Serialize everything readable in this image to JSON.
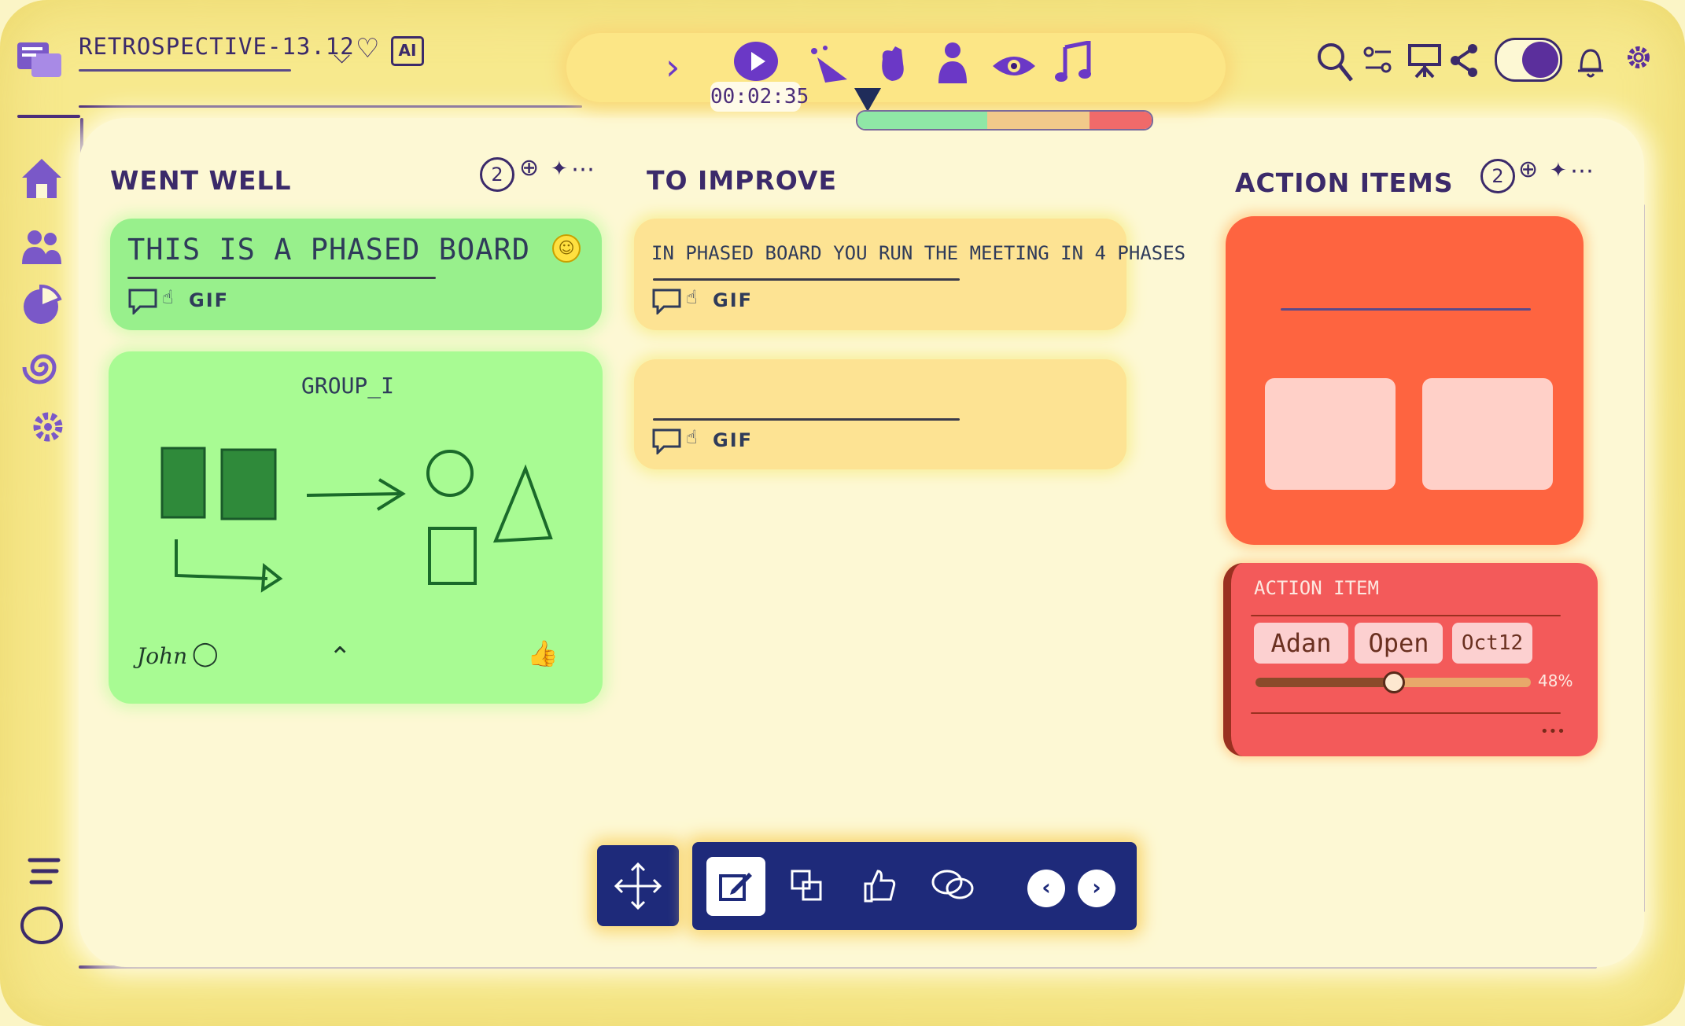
{
  "header": {
    "title": "RETROSPECTIVE-13.12",
    "chevron_icon": "⌵",
    "heart_icon": "♡",
    "ai_label": "AI"
  },
  "phases": {
    "chevron": "›",
    "timer": "00:02:35",
    "icons": [
      "play-icon",
      "party-icon",
      "hand-icon",
      "person-icon",
      "eye-icon",
      "music-icon"
    ],
    "progress": [
      {
        "fraction": 0.44,
        "color": "#8fe7a6"
      },
      {
        "fraction": 0.35,
        "color": "#f1c98a"
      },
      {
        "fraction": 0.21,
        "color": "#f06a6a"
      }
    ]
  },
  "topbar_right": [
    "search-icon",
    "filter-icon",
    "presentation-icon",
    "share-icon",
    "theme-toggle",
    "bell-icon",
    "settings-icon"
  ],
  "sidebar": [
    "home-icon",
    "team-icon",
    "chart-icon",
    "spiral-icon",
    "settings-icon",
    "menu-icon",
    "circle-icon"
  ],
  "columns": [
    {
      "title": "WENT WELL",
      "count": "2",
      "cards": [
        {
          "text": "THIS IS A PHASED BOARD",
          "actions": "GIF",
          "reaction": "☺"
        },
        {
          "group_title": "GROUP_I",
          "author": "John",
          "actions_icons": [
            "comment-icon",
            "collapse-icon",
            "thumbs-up-icon"
          ]
        }
      ]
    },
    {
      "title": "TO IMPROVE",
      "cards": [
        {
          "text": "IN PHASED BOARD YOU RUN THE MEETING IN 4 PHASES",
          "actions": "GIF"
        },
        {
          "text": "",
          "actions": "GIF"
        }
      ]
    },
    {
      "title": "ACTION ITEMS",
      "count": "2",
      "action_item": {
        "title": "ACTION ITEM",
        "assignee": "Adan",
        "status": "Open",
        "due": "Oct12",
        "progress_label": "48%",
        "progress": 0.48,
        "more": "•••"
      }
    }
  ],
  "toolbar": {
    "tools": [
      "move-icon",
      "edit-icon",
      "group-icon",
      "vote-icon",
      "discuss-icon"
    ],
    "prev": "‹",
    "next": "›"
  },
  "colors": {
    "accent": "#6b38c6",
    "green_card": "#98f08c",
    "yellow_card": "#fde393",
    "red_card": "#fe6440",
    "toolbar": "#1e2a7a"
  }
}
